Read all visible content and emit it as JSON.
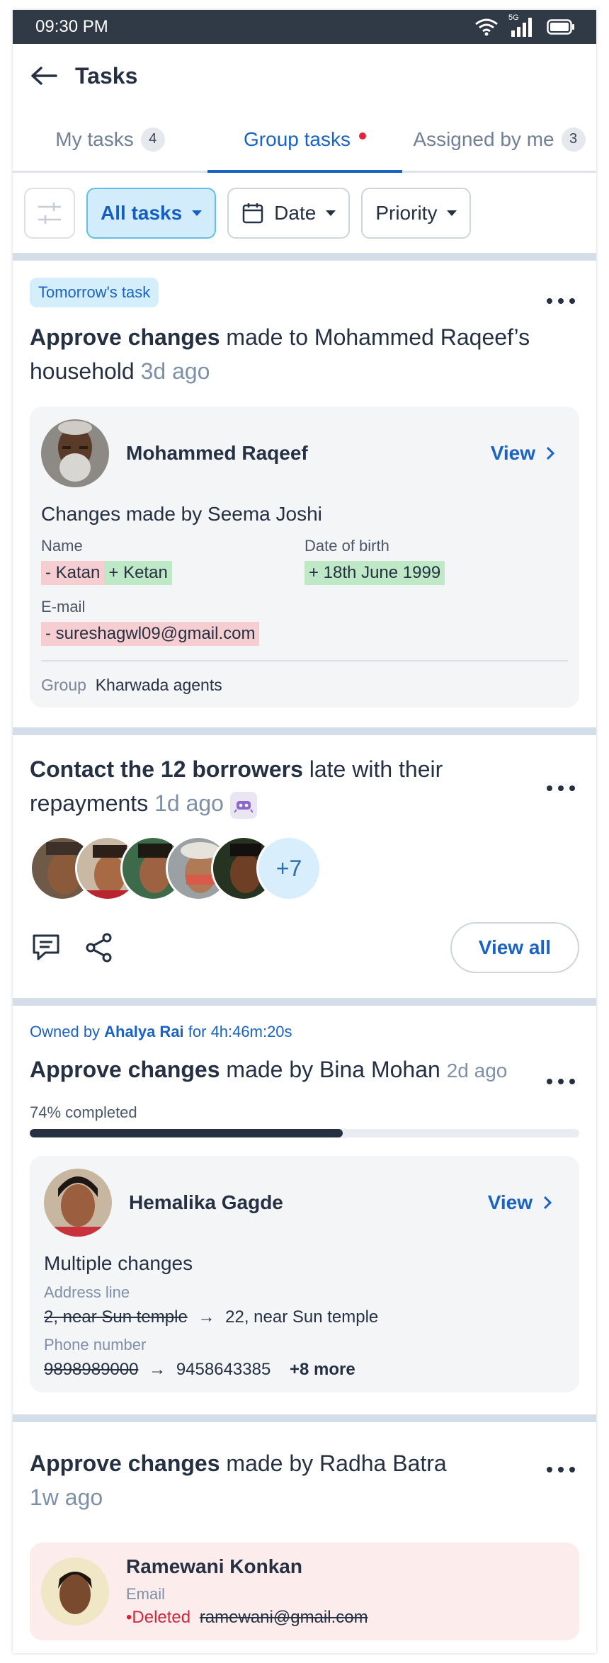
{
  "status": {
    "time": "09:30 PM",
    "network": "5G"
  },
  "header": {
    "title": "Tasks"
  },
  "tabs": [
    {
      "label": "My tasks",
      "count": "4"
    },
    {
      "label": "Group tasks"
    },
    {
      "label": "Assigned by me",
      "count": "3"
    }
  ],
  "filters": {
    "all_tasks": "All tasks",
    "date": "Date",
    "priority": "Priority"
  },
  "card1": {
    "badge": "Tomorrow's task",
    "title_bold": "Approve changes",
    "title_rest": " made to Mohammed Raqeef’s household",
    "ago": "3d ago",
    "person": "Mohammed Raqeef",
    "view": "View",
    "changes_by": "Changes made by Seema Joshi",
    "name_label": "Name",
    "name_old": "- Katan",
    "name_new": "+ Ketan",
    "dob_label": "Date of birth",
    "dob_new": "+ 18th June 1999",
    "email_label": "E-mail",
    "email_old": "- sureshagwl09@gmail.com",
    "group_label": "Group",
    "group_value": "Kharwada agents"
  },
  "card2": {
    "title_bold": "Contact the 12 borrowers",
    "title_rest": " late with their repayments",
    "ago": "1d ago",
    "more_count": "+7",
    "view_all": "View all"
  },
  "card3": {
    "owned_pre": "Owned by ",
    "owner": "Ahalya Rai",
    "owned_post": " for 4h:46m:20s",
    "title_bold": "Approve changes",
    "title_rest": " made by Bina Mohan",
    "ago": "2d ago",
    "progress_label": "74% completed",
    "progress": 0.57,
    "person": "Hemalika Gagde",
    "view": "View",
    "multiple": "Multiple changes",
    "addr_label": "Address line",
    "addr_old": "2, near Sun temple",
    "addr_new": "22, near Sun temple",
    "phone_label": "Phone number",
    "phone_old": "9898989000",
    "phone_new": "9458643385",
    "more_changes": "+8 more",
    "arrow": "→"
  },
  "card4": {
    "title_bold": "Approve changes",
    "title_rest": " made by Radha Batra",
    "ago": "1w ago",
    "person": "Ramewani Konkan",
    "email_label": "Email",
    "deleted": "Deleted",
    "email_old": "ramewani@gmail.com"
  },
  "colors": {
    "accent": "#1a63c4",
    "badge_bg": "#d4eefc",
    "removed": "#f6cdd0",
    "added": "#bfe9c6",
    "danger": "#d2273a"
  }
}
